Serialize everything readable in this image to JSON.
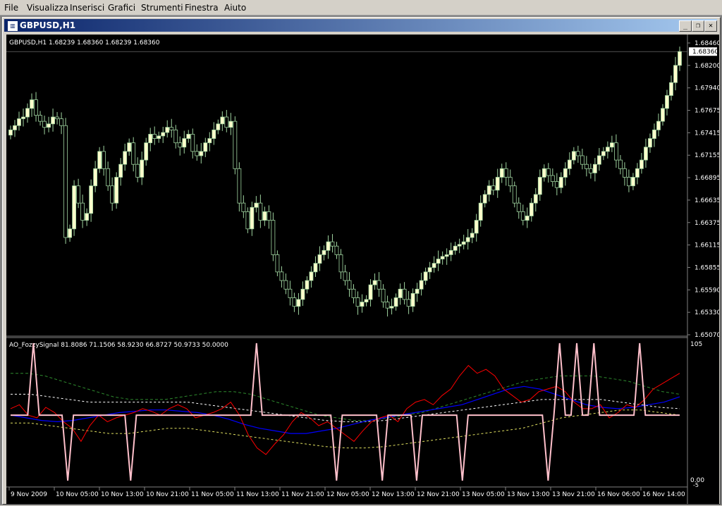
{
  "menu": [
    "File",
    "Visualizza",
    "Inserisci",
    "Grafici",
    "Strumenti",
    "Finestra",
    "Aiuto"
  ],
  "window": {
    "title": "GBPUSD,H1",
    "minimize_icon": "minimize-icon",
    "restore_icon": "restore-icon",
    "close_icon": "close-icon"
  },
  "main_chart": {
    "header": "GBPUSD,H1  1.68239 1.68360 1.68239 1.68360",
    "current_price": "1.68360",
    "price_labels": [
      "1.68460",
      "1.68200",
      "1.67940",
      "1.67675",
      "1.67415",
      "1.67155",
      "1.66895",
      "1.66635",
      "1.66375",
      "1.66115",
      "1.65855",
      "1.65590",
      "1.65330",
      "1.65070"
    ]
  },
  "indicator": {
    "header": "AO_FozzySignal 81.8086 71.1506 58.9230 66.8727 50.9733 50.0000",
    "axis_top": "105",
    "axis_bottom": "0.00",
    "axis_bottom2": "-5"
  },
  "time_labels": [
    "9 Nov 2009",
    "10 Nov 05:00",
    "10 Nov 13:00",
    "10 Nov 21:00",
    "11 Nov 05:00",
    "11 Nov 13:00",
    "11 Nov 21:00",
    "12 Nov 05:00",
    "12 Nov 13:00",
    "12 Nov 21:00",
    "13 Nov 05:00",
    "13 Nov 13:00",
    "13 Nov 21:00",
    "16 Nov 06:00",
    "16 Nov 14:00"
  ],
  "colors": {
    "bull": "#ffffcc",
    "bear": "#000000",
    "wick": "#9fd39f",
    "pink": "#ffc0cb",
    "red": "#ff0000",
    "blue": "#0000ff",
    "green": "#2e8b2e",
    "yellow": "#e0e060",
    "white": "#ffffff"
  },
  "chart_data": [
    {
      "type": "candlestick",
      "symbol": "GBPUSD",
      "timeframe": "H1",
      "ylim": [
        1.6507,
        1.6846
      ],
      "close": [
        1.6745,
        1.675,
        1.6758,
        1.676,
        1.677,
        1.678,
        1.6762,
        1.6755,
        1.6748,
        1.6752,
        1.676,
        1.6758,
        1.675,
        1.662,
        1.663,
        1.668,
        1.666,
        1.664,
        1.6648,
        1.668,
        1.67,
        1.672,
        1.67,
        1.668,
        1.666,
        1.669,
        1.6705,
        1.672,
        1.673,
        1.6705,
        1.669,
        1.671,
        1.673,
        1.674,
        1.6735,
        1.6738,
        1.6742,
        1.6748,
        1.6745,
        1.673,
        1.6725,
        1.6735,
        1.674,
        1.672,
        1.6715,
        1.672,
        1.673,
        1.6735,
        1.6745,
        1.6752,
        1.676,
        1.6748,
        1.6755,
        1.67,
        1.666,
        1.665,
        1.663,
        1.6655,
        1.666,
        1.664,
        1.665,
        1.664,
        1.66,
        1.658,
        1.657,
        1.656,
        1.655,
        1.654,
        1.6548,
        1.656,
        1.657,
        1.658,
        1.659,
        1.66,
        1.6605,
        1.6615,
        1.661,
        1.66,
        1.658,
        1.657,
        1.656,
        1.655,
        1.654,
        1.6545,
        1.6548,
        1.6565,
        1.657,
        1.656,
        1.6545,
        1.6538,
        1.654,
        1.655,
        1.656,
        1.6548,
        1.654,
        1.6555,
        1.656,
        1.657,
        1.658,
        1.6585,
        1.659,
        1.6595,
        1.6598,
        1.66,
        1.6605,
        1.661,
        1.6612,
        1.6615,
        1.662,
        1.6625,
        1.664,
        1.666,
        1.667,
        1.668,
        1.6675,
        1.669,
        1.67,
        1.669,
        1.668,
        1.666,
        1.665,
        1.664,
        1.6645,
        1.666,
        1.667,
        1.669,
        1.67,
        1.6692,
        1.6685,
        1.6678,
        1.669,
        1.67,
        1.671,
        1.672,
        1.6715,
        1.6705,
        1.67,
        1.6695,
        1.6705,
        1.6715,
        1.672,
        1.6725,
        1.673,
        1.671,
        1.67,
        1.669,
        1.668,
        1.669,
        1.67,
        1.671,
        1.6725,
        1.6735,
        1.6745,
        1.6755,
        1.677,
        1.6785,
        1.68,
        1.682,
        1.6836
      ]
    },
    {
      "type": "line",
      "title": "AO_FozzySignal",
      "ylim": [
        0,
        105
      ],
      "series": [
        {
          "name": "signal",
          "values": [
            50,
            50,
            50,
            50,
            105,
            50,
            50,
            50,
            50,
            50,
            0,
            50,
            50,
            50,
            50,
            50,
            50,
            50,
            50,
            50,
            50,
            0,
            50,
            50,
            50,
            50,
            50,
            50,
            50,
            50,
            50,
            50,
            50,
            50,
            50,
            50,
            50,
            50,
            50,
            50,
            50,
            50,
            50,
            105,
            50,
            50,
            50,
            50,
            50,
            50,
            50,
            50,
            50,
            50,
            50,
            50,
            50,
            0,
            50,
            50,
            50,
            50,
            50,
            50,
            50,
            0,
            50,
            50,
            50,
            50,
            50,
            0,
            50,
            50,
            50,
            50,
            50,
            50,
            50,
            0,
            50,
            50,
            50,
            50,
            50,
            50,
            50,
            50,
            50,
            50,
            50,
            50,
            50,
            50,
            0,
            50,
            105,
            50,
            50,
            105,
            50,
            50,
            105,
            50,
            50,
            50,
            50,
            50,
            50,
            50,
            105,
            50,
            50,
            50,
            50,
            50,
            50,
            50
          ]
        },
        {
          "name": "red",
          "values": [
            55,
            58,
            50,
            48,
            56,
            52,
            45,
            40,
            30,
            42,
            50,
            45,
            48,
            50,
            52,
            55,
            53,
            50,
            55,
            58,
            55,
            48,
            50,
            52,
            55,
            60,
            50,
            35,
            25,
            20,
            28,
            35,
            45,
            52,
            48,
            42,
            45,
            40,
            35,
            30,
            38,
            45,
            48,
            50,
            45,
            55,
            60,
            62,
            58,
            65,
            70,
            80,
            88,
            82,
            85,
            80,
            70,
            65,
            60,
            62,
            68,
            70,
            72,
            68,
            60,
            55,
            55,
            58,
            48,
            52,
            58,
            56,
            62,
            70,
            74,
            78,
            82
          ]
        },
        {
          "name": "blue",
          "values": [
            50,
            48,
            46,
            45,
            46,
            48,
            50,
            52,
            53,
            54,
            54,
            53,
            52,
            50,
            47,
            43,
            40,
            38,
            36,
            36,
            38,
            40,
            43,
            46,
            48,
            50,
            52,
            54,
            56,
            58,
            62,
            66,
            70,
            72,
            70,
            66,
            62,
            58,
            56,
            55,
            56,
            58,
            60,
            64
          ]
        },
        {
          "name": "green_band",
          "values": [
            82,
            82,
            80,
            76,
            72,
            68,
            64,
            62,
            62,
            62,
            64,
            66,
            68,
            68,
            66,
            62,
            58,
            54,
            50,
            48,
            46,
            46,
            48,
            50,
            52,
            56,
            60,
            64,
            68,
            72,
            76,
            78,
            80,
            80,
            80,
            78,
            76,
            72,
            68,
            66
          ]
        },
        {
          "name": "white_band",
          "values": [
            66,
            66,
            64,
            62,
            60,
            60,
            60,
            60,
            60,
            60,
            58,
            56,
            54,
            52,
            50,
            48,
            46,
            45,
            45,
            46,
            48,
            50,
            52,
            54,
            56,
            58,
            60,
            62,
            62,
            62,
            62,
            60,
            58,
            56,
            55
          ]
        },
        {
          "name": "yellow_band",
          "values": [
            44,
            44,
            42,
            40,
            38,
            36,
            36,
            38,
            40,
            40,
            38,
            36,
            34,
            32,
            30,
            28,
            26,
            25,
            25,
            26,
            28,
            30,
            32,
            34,
            36,
            38,
            40,
            44,
            48,
            50,
            52,
            54,
            54,
            52,
            50
          ]
        }
      ]
    }
  ]
}
